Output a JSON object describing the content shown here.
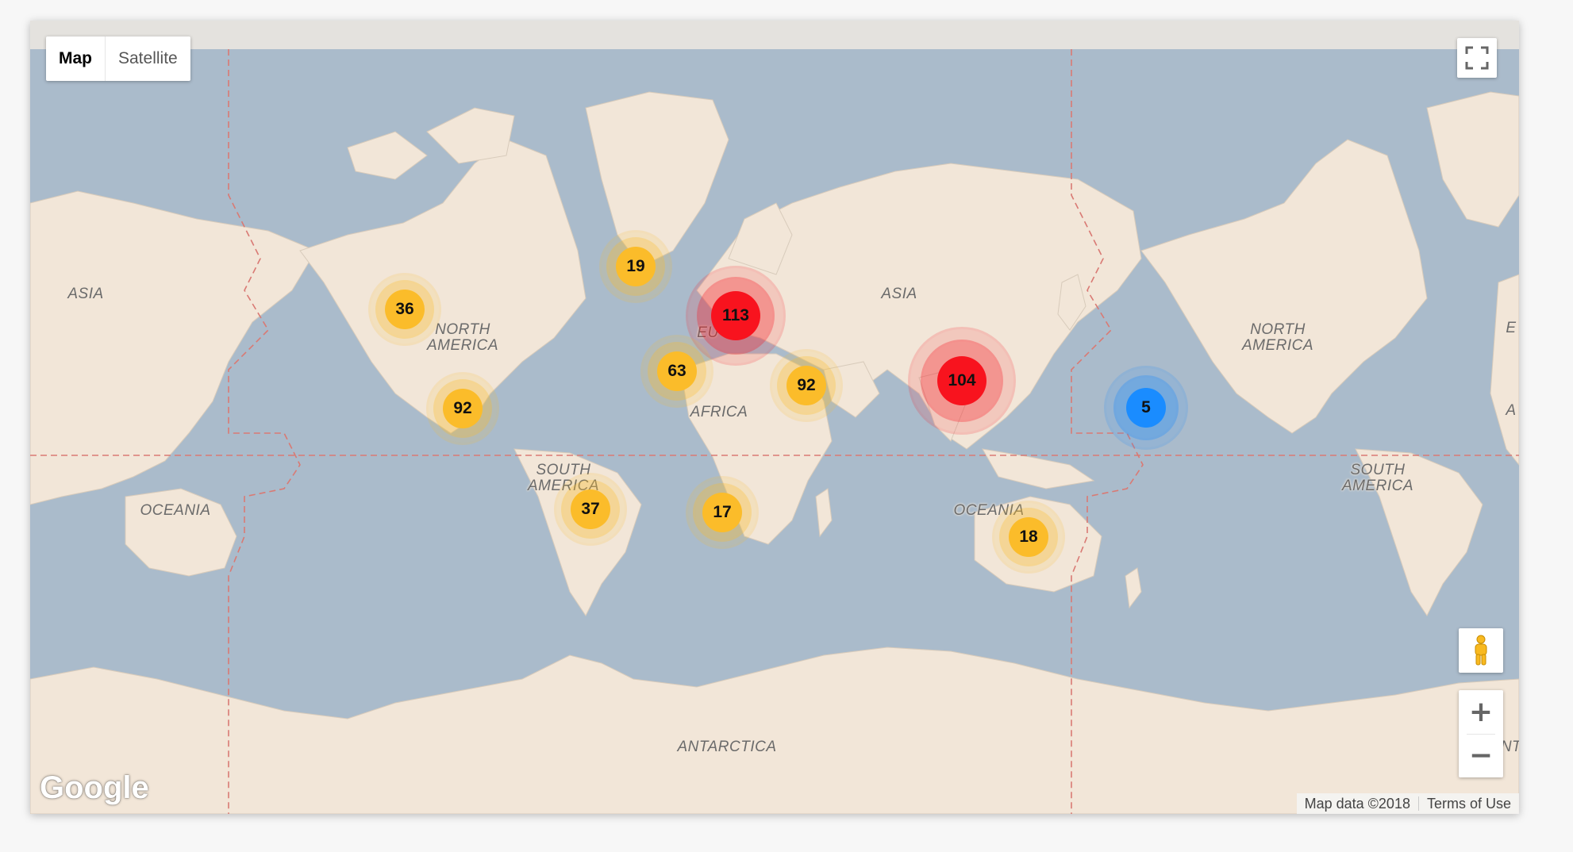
{
  "map_type_control": {
    "map_label": "Map",
    "satellite_label": "Satellite",
    "selected": "Map"
  },
  "region_labels": {
    "asia_left": "ASIA",
    "north_america": "NORTH\nAMERICA",
    "south_america": "SOUTH\nAMERICA",
    "africa": "AFRICA",
    "europe_partial": "EU",
    "asia": "ASIA",
    "oceania_left": "OCEANIA",
    "oceania": "OCEANIA",
    "north_america_right": "NORTH\nAMERICA",
    "south_america_right": "SOUTH\nAMERICA",
    "europe_right_partial": "E",
    "africa_right_partial": "A",
    "antarctica": "ANTARCTICA",
    "antarctica_right_partial": "NT"
  },
  "clusters": [
    {
      "id": "north-america-west",
      "count": "36",
      "color": "#fbbc2a",
      "level": "medium"
    },
    {
      "id": "greenland",
      "count": "19",
      "color": "#fbbc2a",
      "level": "medium"
    },
    {
      "id": "europe",
      "count": "113",
      "color": "#f8131e",
      "level": "high"
    },
    {
      "id": "north-africa",
      "count": "63",
      "color": "#fbbc2a",
      "level": "medium"
    },
    {
      "id": "middle-east",
      "count": "92",
      "color": "#fbbc2a",
      "level": "medium"
    },
    {
      "id": "east-asia",
      "count": "104",
      "color": "#f8131e",
      "level": "high"
    },
    {
      "id": "pacific",
      "count": "5",
      "color": "#1a8cff",
      "level": "low"
    },
    {
      "id": "central-america",
      "count": "92",
      "color": "#fbbc2a",
      "level": "medium"
    },
    {
      "id": "south-america",
      "count": "37",
      "color": "#fbbc2a",
      "level": "medium"
    },
    {
      "id": "southern-africa",
      "count": "17",
      "color": "#fbbc2a",
      "level": "medium"
    },
    {
      "id": "australia",
      "count": "18",
      "color": "#fbbc2a",
      "level": "medium"
    }
  ],
  "controls": {
    "fullscreen_icon": "fullscreen-icon",
    "pegman_icon": "street-view-pegman-icon",
    "zoom_in": "+",
    "zoom_out": "−"
  },
  "branding": {
    "logo": "Google"
  },
  "attribution": {
    "map_data": "Map data ©2018",
    "terms": "Terms of Use"
  },
  "colors": {
    "water": "#aabbcb",
    "land": "#f2e6d8",
    "boundary": "#d97a74"
  }
}
